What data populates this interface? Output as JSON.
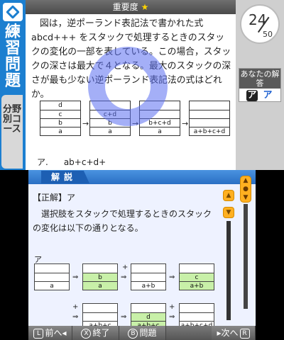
{
  "top": {
    "side_title": "練習問題",
    "side_subtitle": "分野別コース",
    "header_label": "重要度",
    "header_star": "★",
    "question": "図は，逆ポーランド表記法で書かれた式abcd+++ をスタックで処理するときのスタックの変化の一部を表している。この場合，スタックの深さは最大で４となる。最大のスタックの深さが最も少ない逆ポーランド表記法の式はどれか。",
    "stacks": [
      [
        "d",
        "c",
        "b",
        "a"
      ],
      [
        "c+d",
        "b",
        "a"
      ],
      [
        "b+c+d",
        "a"
      ],
      [
        "a+b+c+d"
      ]
    ],
    "arrow": "→",
    "option_label": "ア.",
    "option_text": "ab+c+d+",
    "counter_current": "24",
    "counter_total": "50",
    "your_answer_label": "あなたの解答",
    "your_answer": "ア",
    "correct_answer": "ア"
  },
  "bottom": {
    "section_label": "解説",
    "correct_line": "【正解】ア",
    "explanation": "選択肢をスタックで処理するときのスタックの変化は以下の通りとなる。",
    "diagram_label": "ア",
    "row1": [
      {
        "cells": [
          "",
          "",
          "a"
        ]
      },
      {
        "cells": [
          "",
          "b",
          "a"
        ]
      },
      {
        "cells": [
          "",
          "",
          "a+b"
        ]
      },
      {
        "cells": [
          "",
          "c",
          "a+b"
        ]
      }
    ],
    "row2": [
      {
        "cells": [
          "",
          "",
          "a+b+c"
        ]
      },
      {
        "cells": [
          "",
          "d",
          "a+b+c"
        ]
      },
      {
        "cells": [
          "",
          "",
          "a+b+c+d"
        ]
      }
    ],
    "ops": {
      "arrow": "⇒",
      "plus": "+"
    }
  },
  "footer": {
    "prev_key": "L",
    "prev_label": "前へ◂",
    "end_key": "X",
    "end_label": "終了",
    "question_key": "B",
    "question_label": "問題",
    "next_label": "▸次へ",
    "next_key": "R"
  },
  "colors": {
    "accent_blue": "#1c7fd0",
    "highlight_green": "#c8f0a8",
    "scroll_orange": "#ffb020",
    "ring_blue": "#5a6ef0"
  }
}
